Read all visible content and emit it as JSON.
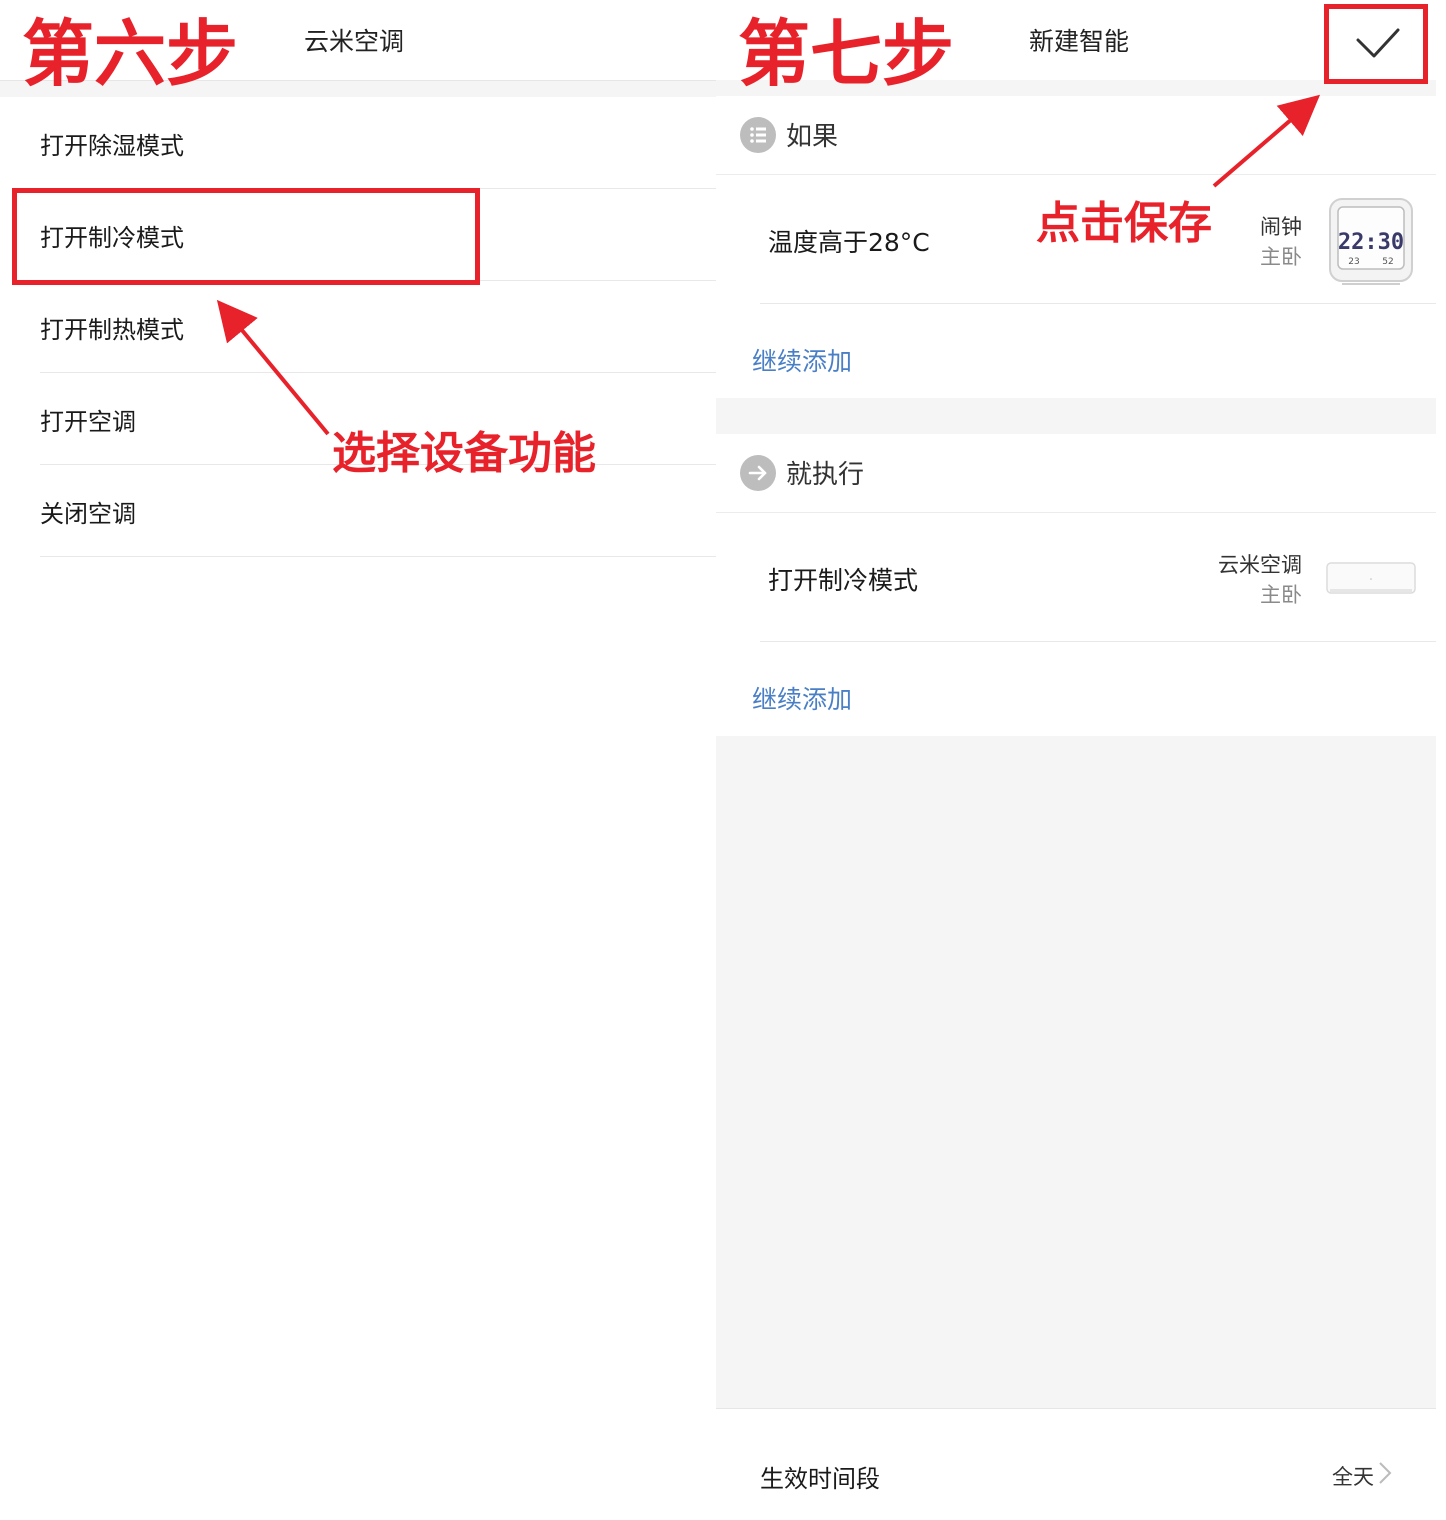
{
  "left_screen": {
    "title": "云米空调",
    "items": [
      {
        "label": "打开除湿模式"
      },
      {
        "label": "打开制冷模式"
      },
      {
        "label": "打开制热模式"
      },
      {
        "label": "打开空调"
      },
      {
        "label": "关闭空调"
      }
    ]
  },
  "right_screen": {
    "title": "新建智能",
    "confirm_icon": "check-icon",
    "if_section": {
      "label": "如果",
      "icon": "list-icon",
      "condition": "温度高于28°C",
      "device_name": "闹钟",
      "device_room": "主卧",
      "device_clock_time": "22:30",
      "device_clock_temp": "23",
      "device_clock_humidity": "52",
      "add_label": "继续添加"
    },
    "then_section": {
      "label": "就执行",
      "icon": "arrow-right-icon",
      "action": "打开制冷模式",
      "device_name": "云米空调",
      "device_room": "主卧",
      "add_label": "继续添加"
    },
    "effective_time": {
      "label": "生效时间段",
      "value": "全天"
    }
  },
  "annotations": {
    "step6": "第六步",
    "step7": "第七步",
    "select_function": "选择设备功能",
    "click_save": "点击保存",
    "color": "#e8222a"
  }
}
